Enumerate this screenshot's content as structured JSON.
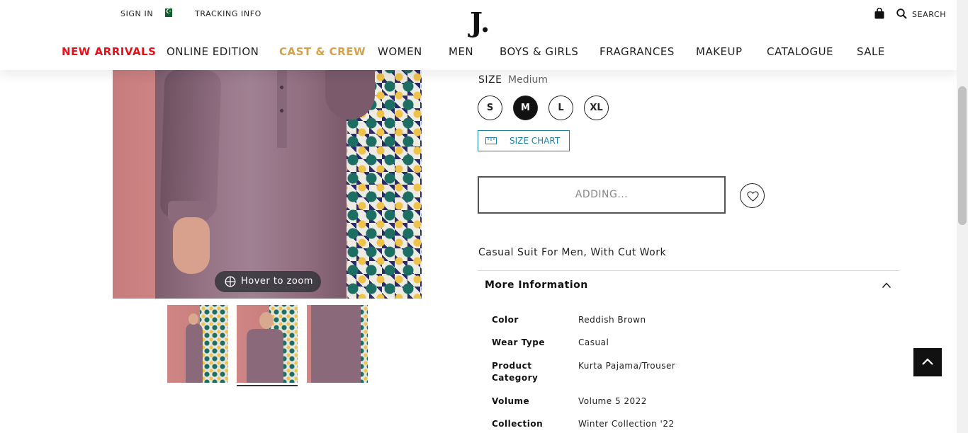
{
  "header": {
    "sign_in": "SIGN IN",
    "tracking": "TRACKING INFO",
    "logo": "J.",
    "search": "SEARCH"
  },
  "nav": [
    {
      "label": "NEW ARRIVALS",
      "color": "#e8101a"
    },
    {
      "label": "ONLINE EDITION"
    },
    {
      "label": "CAST & CREW",
      "color": "#d4a24a"
    },
    {
      "label": "WOMEN"
    },
    {
      "label": "MEN"
    },
    {
      "label": "BOYS & GIRLS"
    },
    {
      "label": "FRAGRANCES"
    },
    {
      "label": "MAKEUP"
    },
    {
      "label": "CATALOGUE"
    },
    {
      "label": "SALE"
    }
  ],
  "gallery": {
    "zoom_hint": "Hover to zoom",
    "thumbnails": 3,
    "active_thumbnail": 2
  },
  "product": {
    "size_label": "SIZE",
    "size_selected": "Medium",
    "sizes": [
      "S",
      "M",
      "L",
      "XL"
    ],
    "size_chart": "SIZE CHART",
    "add_button": "ADDING...",
    "description": "Casual Suit For Men, With Cut Work",
    "more_info_title": "More Information",
    "attributes": [
      {
        "name": "Color",
        "value": "Reddish Brown"
      },
      {
        "name": "Wear Type",
        "value": "Casual"
      },
      {
        "name": "Product Category",
        "value": "Kurta Pajama/Trouser"
      },
      {
        "name": "Volume",
        "value": "Volume 5 2022"
      },
      {
        "name": "Collection",
        "value": "Winter Collection '22"
      }
    ]
  },
  "colors": {
    "accent_red": "#e8101a",
    "accent_gold": "#d4a24a",
    "link_blue": "#1e7fa7"
  }
}
